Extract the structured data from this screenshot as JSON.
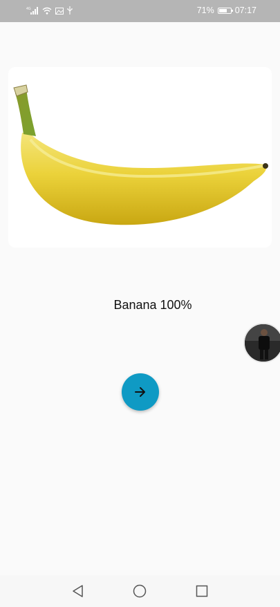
{
  "status_bar": {
    "network_label": "4G",
    "battery_percent": "71%",
    "battery_level": 0.71,
    "time": "07:17",
    "icons": [
      "signal-icon",
      "wifi-icon",
      "image-icon",
      "usb-icon",
      "battery-icon"
    ]
  },
  "main": {
    "image_subject": "banana",
    "result_label": "Banana 100%",
    "fab_icon": "arrow-right-icon"
  },
  "navigation": {
    "buttons": [
      "back-icon",
      "home-icon",
      "recents-icon"
    ]
  },
  "colors": {
    "fab": "#0f9ac4",
    "background": "#fafafa",
    "status_bar": "#b5b5b5"
  }
}
